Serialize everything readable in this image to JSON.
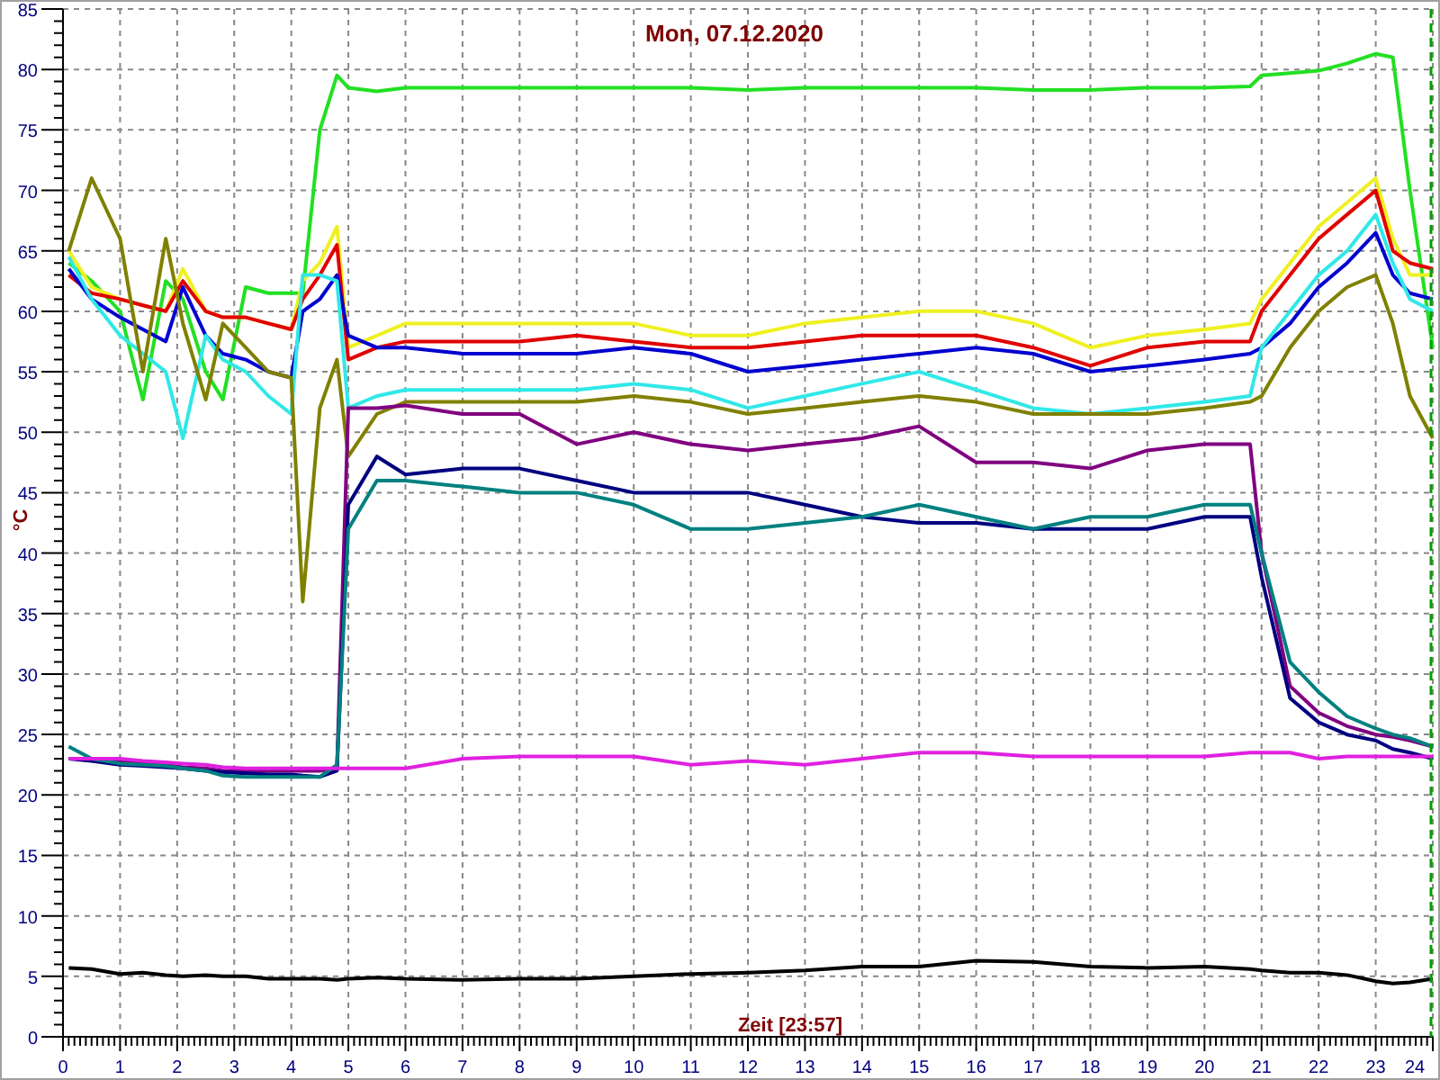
{
  "chart": {
    "chart_data": {
      "type": "line",
      "title": "Mon, 07.12.2020",
      "xlabel": "Zeit [23:57]",
      "ylabel": "°C",
      "xlim": [
        0,
        24
      ],
      "ylim": [
        0,
        85
      ],
      "xticks": [
        0,
        1,
        2,
        3,
        4,
        5,
        6,
        7,
        8,
        9,
        10,
        11,
        12,
        13,
        14,
        15,
        16,
        17,
        18,
        19,
        20,
        21,
        22,
        23,
        24
      ],
      "yticks": [
        0,
        5,
        10,
        15,
        20,
        25,
        30,
        35,
        40,
        45,
        50,
        55,
        60,
        65,
        70,
        75,
        80,
        85
      ],
      "x": [
        0.1,
        0.5,
        1,
        1.4,
        1.8,
        2.1,
        2.5,
        2.8,
        3.2,
        3.6,
        4,
        4.2,
        4.5,
        4.8,
        5,
        5.5,
        6,
        7,
        8,
        9,
        10,
        11,
        12,
        13,
        14,
        15,
        16,
        17,
        18,
        19,
        20,
        20.8,
        21,
        21.5,
        22,
        22.5,
        23,
        23.3,
        23.6,
        24
      ],
      "series": [
        {
          "color": "#22e022",
          "values": [
            64,
            62.5,
            60,
            52.7,
            62.5,
            61,
            55,
            52.7,
            62,
            61.5,
            61.5,
            61.5,
            75,
            79.5,
            78.5,
            78.2,
            78.5,
            78.5,
            78.5,
            78.5,
            78.5,
            78.5,
            78.3,
            78.5,
            78.5,
            78.5,
            78.5,
            78.3,
            78.3,
            78.5,
            78.5,
            78.6,
            79.5,
            79.7,
            79.9,
            80.5,
            81.3,
            81,
            70,
            57
          ]
        },
        {
          "color": "#f0f020",
          "values": [
            65,
            62,
            61,
            60.5,
            60,
            63.5,
            60,
            59.5,
            59.5,
            59,
            58.5,
            62.5,
            64,
            67,
            57,
            58,
            59,
            59,
            59,
            59,
            59,
            58,
            58,
            59,
            59.5,
            60,
            60,
            59,
            57,
            58,
            58.5,
            59,
            61,
            64,
            67,
            69,
            71,
            66,
            63,
            63
          ]
        },
        {
          "color": "#e00000",
          "values": [
            63,
            61.5,
            61,
            60.5,
            60,
            62.5,
            60,
            59.5,
            59.5,
            59,
            58.5,
            61,
            63,
            65.5,
            56,
            57,
            57.5,
            57.5,
            57.5,
            58,
            57.5,
            57,
            57,
            57.5,
            58,
            58,
            58,
            57,
            55.5,
            57,
            57.5,
            57.5,
            60,
            63,
            66,
            68,
            70,
            65,
            64,
            63.5
          ]
        },
        {
          "color": "#0000d0",
          "values": [
            63.5,
            61,
            59.5,
            58.5,
            57.5,
            62,
            58,
            56.5,
            56,
            55,
            54.5,
            60,
            61,
            63,
            58,
            57,
            57,
            56.5,
            56.5,
            56.5,
            57,
            56.5,
            55,
            55.5,
            56,
            56.5,
            57,
            56.5,
            55,
            55.5,
            56,
            56.5,
            57,
            59,
            62,
            64,
            66.5,
            63,
            61.5,
            61
          ]
        },
        {
          "color": "#30e8e8",
          "values": [
            64.5,
            61,
            58,
            56.5,
            55,
            49.5,
            58,
            56,
            55,
            53,
            51.5,
            63,
            63,
            62.5,
            52,
            53,
            53.5,
            53.5,
            53.5,
            53.5,
            54,
            53.5,
            52,
            53,
            54,
            55,
            53.5,
            52,
            51.5,
            52,
            52.5,
            53,
            57,
            60,
            63,
            65,
            68,
            64,
            61,
            60
          ]
        },
        {
          "color": "#808000",
          "values": [
            65,
            71,
            66,
            55,
            66,
            59,
            52.7,
            59,
            57,
            55,
            54.5,
            36,
            52,
            56,
            48,
            51.5,
            52.5,
            52.5,
            52.5,
            52.5,
            53,
            52.5,
            51.5,
            52,
            52.5,
            53,
            52.5,
            51.5,
            51.5,
            51.5,
            52,
            52.5,
            53,
            57,
            60,
            62,
            63,
            59,
            53,
            49.5
          ]
        },
        {
          "color": "#800080",
          "values": [
            23,
            23,
            22.8,
            22.6,
            22.5,
            22.3,
            22.2,
            22,
            22,
            22,
            22,
            22,
            22,
            22.2,
            52,
            52,
            52.2,
            51.5,
            51.5,
            49,
            50,
            49,
            48.5,
            49,
            49.5,
            50.5,
            47.5,
            47.5,
            47,
            48.5,
            49,
            49,
            40,
            29,
            26.8,
            25.7,
            25,
            24.8,
            24.5,
            24
          ]
        },
        {
          "color": "#000080",
          "values": [
            23,
            22.8,
            22.5,
            22.4,
            22.3,
            22.2,
            22,
            21.9,
            21.8,
            21.7,
            21.7,
            21.6,
            21.5,
            22,
            44,
            48,
            46.5,
            47,
            47,
            46,
            45,
            45,
            45,
            44,
            43,
            42.5,
            42.5,
            42,
            42,
            42,
            43,
            43,
            38,
            28,
            26,
            25,
            24.5,
            23.8,
            23.5,
            23
          ]
        },
        {
          "color": "#008080",
          "values": [
            24,
            23,
            22.6,
            22.5,
            22.4,
            22.2,
            22,
            21.6,
            21.5,
            21.5,
            21.5,
            21.5,
            21.5,
            22.5,
            42,
            46,
            46,
            45.5,
            45,
            45,
            44,
            42,
            42,
            42.5,
            43,
            44,
            43,
            42,
            43,
            43,
            44,
            44,
            40,
            31,
            28.5,
            26.5,
            25.5,
            25,
            24.7,
            24
          ]
        },
        {
          "color": "#e020e0",
          "values": [
            23,
            23,
            23,
            22.8,
            22.7,
            22.6,
            22.5,
            22.3,
            22.2,
            22.2,
            22.2,
            22.2,
            22.2,
            22.2,
            22.2,
            22.2,
            22.2,
            23,
            23.2,
            23.2,
            23.2,
            22.5,
            22.8,
            22.5,
            23,
            23.5,
            23.5,
            23.2,
            23.2,
            23.2,
            23.2,
            23.5,
            23.5,
            23.5,
            23,
            23.2,
            23.2,
            23.2,
            23.2,
            23.2
          ]
        },
        {
          "color": "#000000",
          "values": [
            5.7,
            5.6,
            5.2,
            5.3,
            5.1,
            5,
            5.1,
            5,
            5,
            4.8,
            4.8,
            4.8,
            4.8,
            4.7,
            4.8,
            4.9,
            4.8,
            4.7,
            4.8,
            4.8,
            5,
            5.2,
            5.3,
            5.5,
            5.8,
            5.8,
            6.3,
            6.2,
            5.8,
            5.7,
            5.8,
            5.6,
            5.5,
            5.3,
            5.3,
            5.1,
            4.6,
            4.4,
            4.5,
            4.8
          ]
        }
      ],
      "grid": true
    }
  }
}
